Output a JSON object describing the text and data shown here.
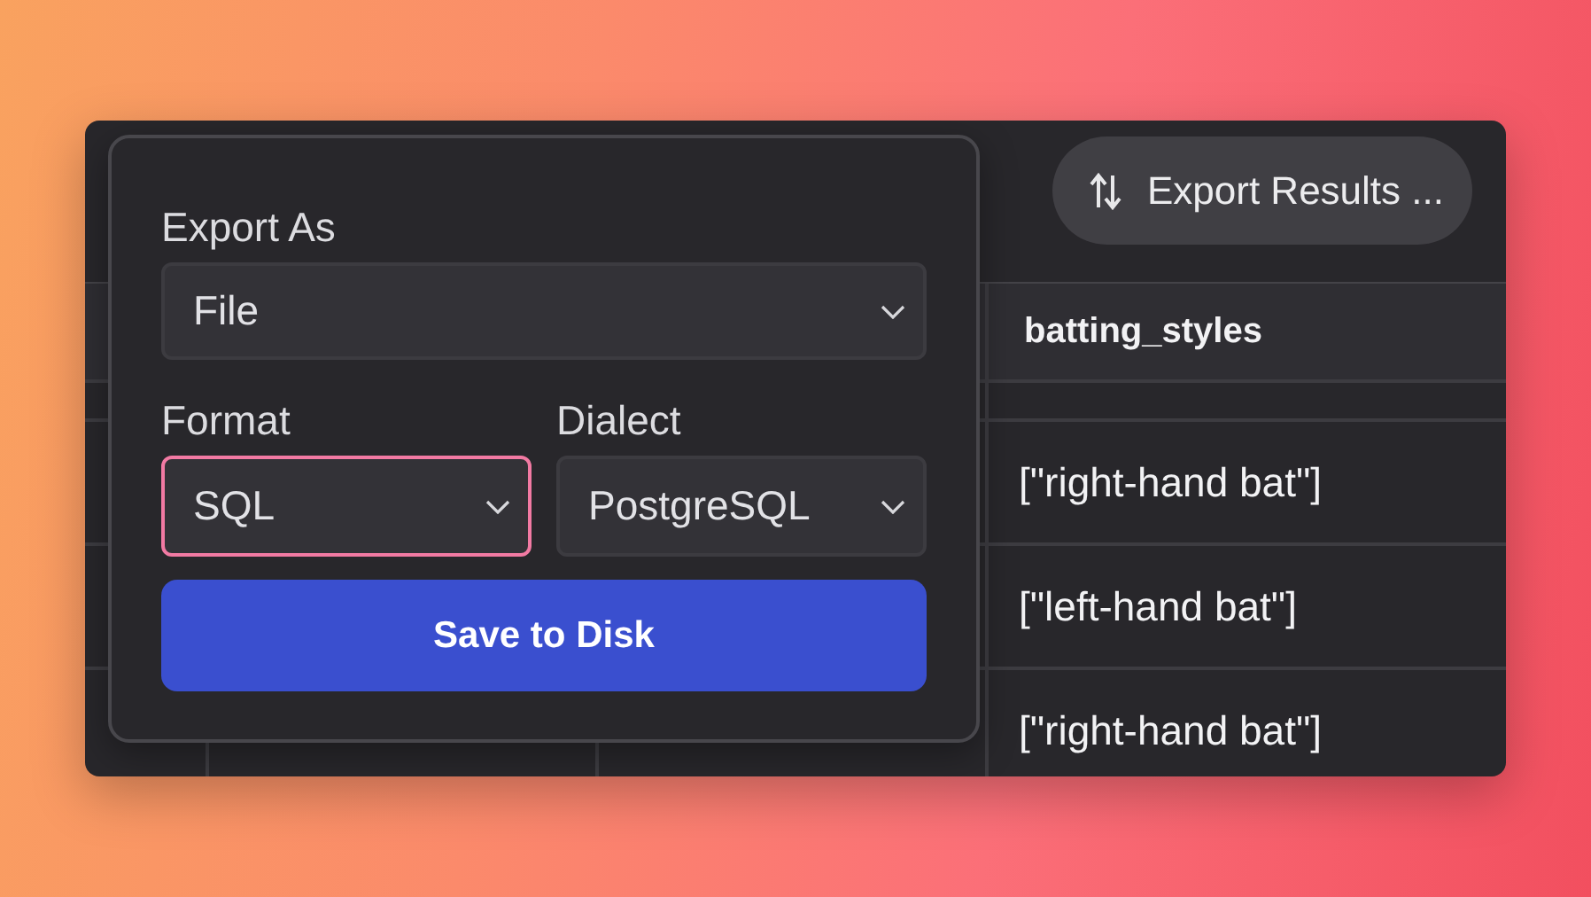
{
  "export_button": {
    "label": "Export Results ..."
  },
  "table": {
    "column_header": "batting_styles",
    "rows": [
      "[\"right-hand bat\"]",
      "[\"left-hand bat\"]",
      "[\"right-hand bat\"]"
    ]
  },
  "export_popup": {
    "export_as": {
      "label": "Export As",
      "value": "File"
    },
    "format": {
      "label": "Format",
      "value": "SQL",
      "focused": true
    },
    "dialect": {
      "label": "Dialect",
      "value": "PostgreSQL",
      "focused": false
    },
    "save_button": {
      "label": "Save to Disk"
    }
  }
}
